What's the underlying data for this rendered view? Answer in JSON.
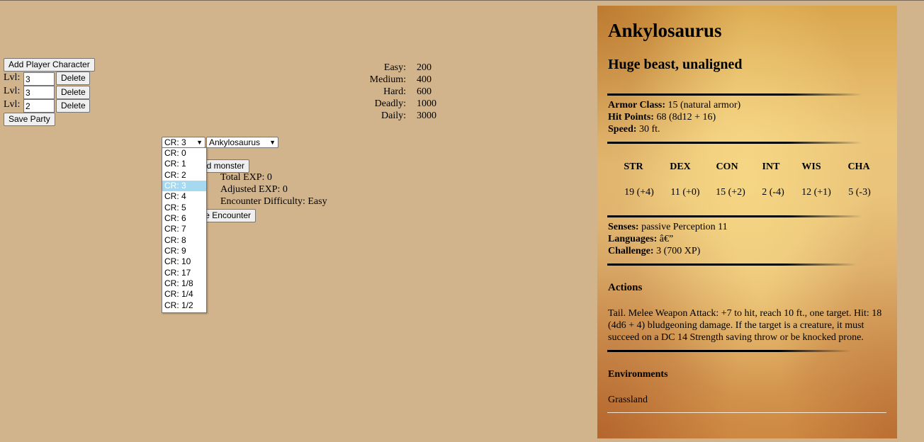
{
  "party": {
    "add_label": "Add Player Character",
    "lvl_label": "Lvl:",
    "delete_label": "Delete",
    "levels": [
      "3",
      "3",
      "2"
    ],
    "save_label": "Save Party"
  },
  "thresholds": [
    {
      "name": "Easy:",
      "value": "200"
    },
    {
      "name": "Medium:",
      "value": "400"
    },
    {
      "name": "Hard:",
      "value": "600"
    },
    {
      "name": "Deadly:",
      "value": "1000"
    },
    {
      "name": "Daily:",
      "value": "3000"
    }
  ],
  "encounter": {
    "cr_selected": "CR: 3",
    "monster_selected": "Ankylosaurus",
    "add_monster_label": "Add monster",
    "total_exp": "Total EXP: 0",
    "adjusted_exp": "Adjusted EXP: 0",
    "difficulty": "Encounter Difficulty: Easy",
    "save_encounter_label": "Save Encounter"
  },
  "cr_options": [
    "CR: 0",
    "CR: 1",
    "CR: 2",
    "CR: 3",
    "CR: 4",
    "CR: 5",
    "CR: 6",
    "CR: 7",
    "CR: 8",
    "CR: 9",
    "CR: 10",
    "CR: 17",
    "CR: 1/8",
    "CR: 1/4",
    "CR: 1/2"
  ],
  "monster": {
    "name": "Ankylosaurus",
    "type": "Huge beast, unaligned",
    "armor_class_label": "Armor Class:",
    "armor_class": "15 (natural armor)",
    "hit_points_label": "Hit Points:",
    "hit_points": "68 (8d12 + 16)",
    "speed_label": "Speed:",
    "speed": "30 ft.",
    "abilities": [
      {
        "name": "STR",
        "value": "19 (+4)"
      },
      {
        "name": "DEX",
        "value": "11 (+0)"
      },
      {
        "name": "CON",
        "value": "15 (+2)"
      },
      {
        "name": "INT",
        "value": "2 (-4)"
      },
      {
        "name": "WIS",
        "value": "12 (+1)"
      },
      {
        "name": "CHA",
        "value": "5 (-3)"
      }
    ],
    "senses_label": "Senses:",
    "senses": "passive Perception 11",
    "languages_label": "Languages:",
    "languages": "â€”",
    "challenge_label": "Challenge:",
    "challenge": "3 (700 XP)",
    "actions_heading": "Actions",
    "action_text": "Tail. Melee Weapon Attack: +7 to hit, reach 10 ft., one target. Hit: 18 (4d6 + 4) bludgeoning damage. If the target is a creature, it must succeed on a DC 14 Strength saving throw or be knocked prone.",
    "environments_heading": "Environments",
    "environment": "Grassland"
  },
  "colors": {
    "page_bg": "#d2b48c",
    "selected_option": "#a6d9f0"
  }
}
